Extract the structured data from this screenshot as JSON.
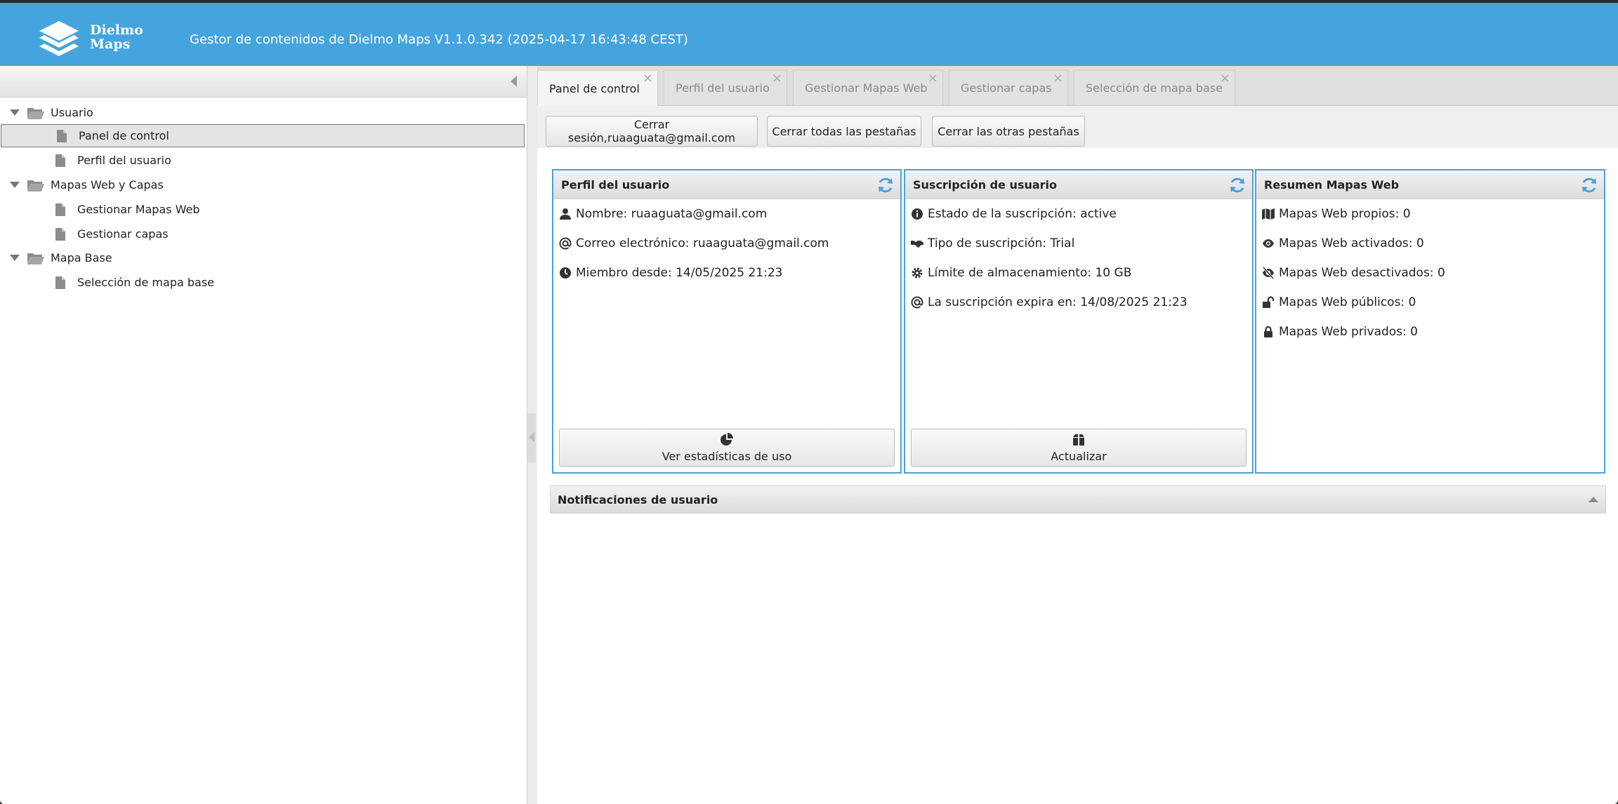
{
  "header": {
    "logo_line1": "Dielmo",
    "logo_line2": "Maps",
    "title": "Gestor de contenidos de Dielmo Maps V1.1.0.342 (2025-04-17 16:43:48 CEST)"
  },
  "tree": {
    "items": [
      {
        "label": "Usuario",
        "type": "folder"
      },
      {
        "label": "Panel de control",
        "type": "file",
        "selected": true
      },
      {
        "label": "Perfil del usuario",
        "type": "file"
      },
      {
        "label": "Mapas Web y Capas",
        "type": "folder"
      },
      {
        "label": "Gestionar Mapas Web",
        "type": "file"
      },
      {
        "label": "Gestionar capas",
        "type": "file"
      },
      {
        "label": "Mapa Base",
        "type": "folder"
      },
      {
        "label": "Selección de mapa base",
        "type": "file"
      }
    ]
  },
  "tabs": [
    {
      "label": "Panel de control",
      "active": true
    },
    {
      "label": "Perfil del usuario"
    },
    {
      "label": "Gestionar Mapas Web"
    },
    {
      "label": "Gestionar capas"
    },
    {
      "label": "Selección de mapa base"
    }
  ],
  "toolbar": {
    "logout": "Cerrar sesión,ruaaguata@gmail.com",
    "close_all": "Cerrar todas las pestañas",
    "close_others": "Cerrar las otras pestañas"
  },
  "profile": {
    "title": "Perfil del usuario",
    "name": "Nombre: ruaaguata@gmail.com",
    "email": "Correo electrónico: ruaaguata@gmail.com",
    "member_since": "Miembro desde: 14/05/2025 21:23",
    "button": "Ver estadísticas de uso"
  },
  "subscription": {
    "title": "Suscripción de usuario",
    "status": "Estado de la suscripción: active",
    "type": "Tipo de suscripción: Trial",
    "storage": "Límite de almacenamiento: 10 GB",
    "expires": "La suscripción expira en: 14/08/2025 21:23",
    "button": "Actualizar"
  },
  "summary": {
    "title": "Resumen Mapas Web",
    "own": "Mapas Web propios: 0",
    "active": "Mapas Web activados: 0",
    "inactive": "Mapas Web desactivados: 0",
    "public": "Mapas Web públicos: 0",
    "private": "Mapas Web privados: 0"
  },
  "notifications": {
    "title": "Notificaciones de usuario"
  },
  "colors": {
    "header": "#44a4de",
    "panel_border": "#4aa0dc"
  }
}
